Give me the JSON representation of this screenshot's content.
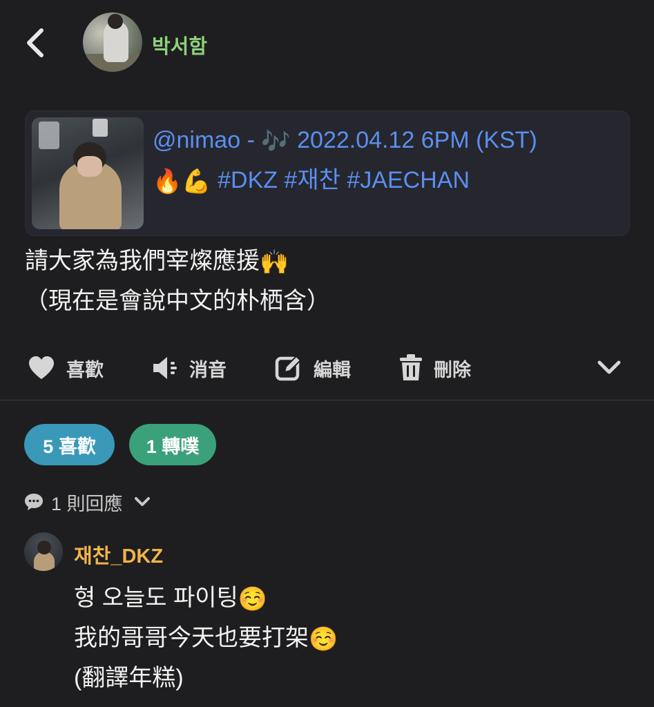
{
  "header": {
    "back_icon": "chevron-left-icon",
    "username": "박서함",
    "username_color": "#8fd17a"
  },
  "quote": {
    "line1_text": "@nimao - ",
    "line1_emoji": "🎶",
    "line1_rest": " 2022.04.12 6PM (KST)",
    "line2_emoji1": "🔥",
    "line2_emoji2": "💪",
    "line2_tags": " #DKZ #재찬 #JAECHAN",
    "link_color": "#5b8ef0"
  },
  "post": {
    "line1": "請大家為我們宰燦應援",
    "line1_emoji": "🙌",
    "line2": "（現在是會說中文的朴栖含）"
  },
  "actions": {
    "like_label": "喜歡",
    "mute_label": "消音",
    "edit_label": "編輯",
    "delete_label": "刪除"
  },
  "stats": {
    "likes_label": "5 喜歡",
    "reblogs_label": "1 轉噗",
    "likes_color": "#3a98b8",
    "reblogs_color": "#3aa17a"
  },
  "replies": {
    "count_label": "1 則回應"
  },
  "reply": {
    "author": "재찬_DKZ",
    "author_color": "#f0b44a",
    "line1": "형 오늘도 파이팅",
    "line1_emoji": "☺️",
    "line2": "我的哥哥今天也要打架",
    "line2_emoji": "☺️",
    "line3": "(翻譯年糕)"
  }
}
